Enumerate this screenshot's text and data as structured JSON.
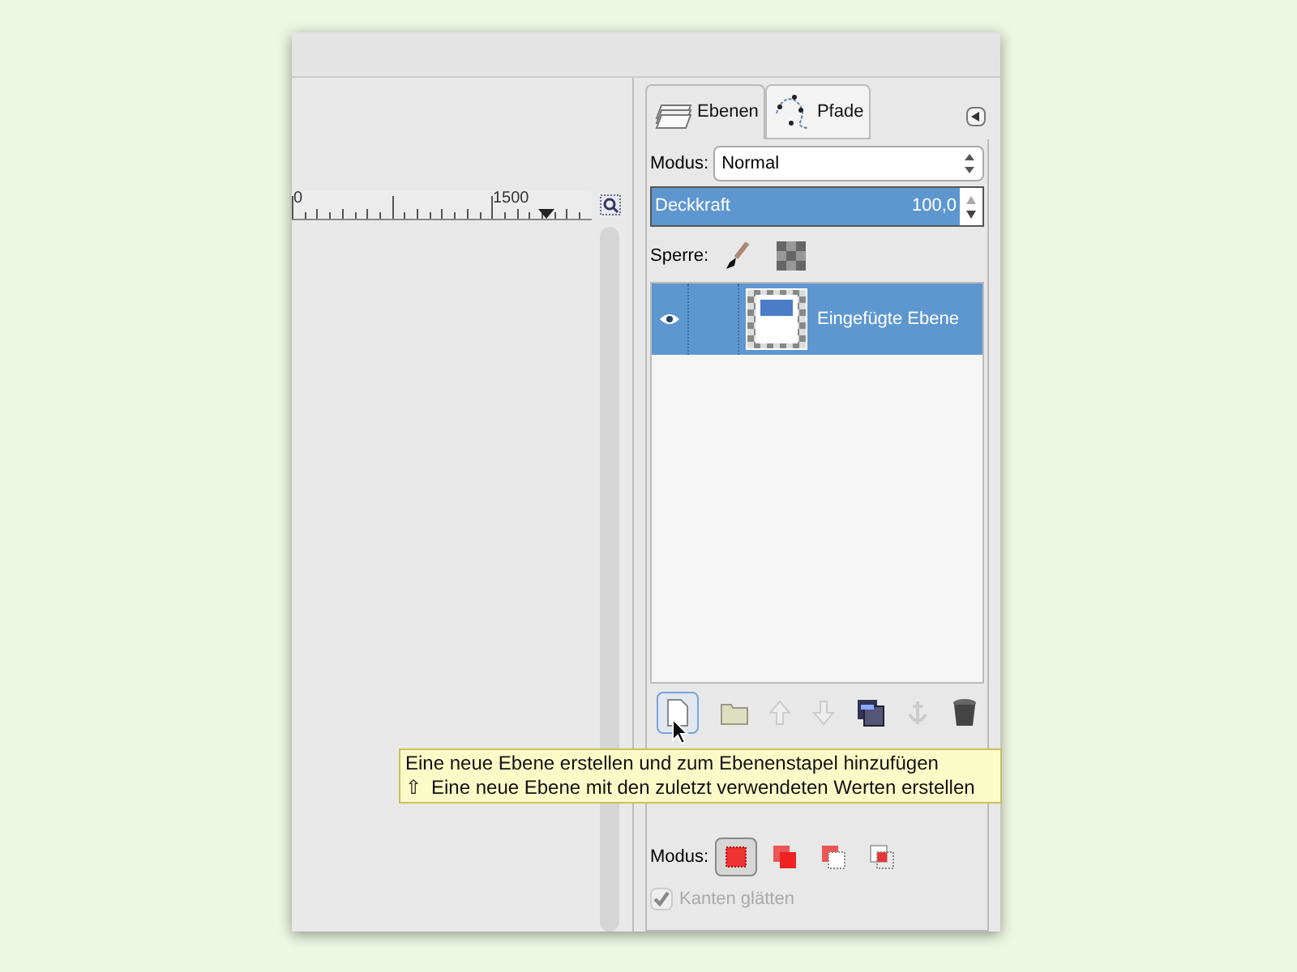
{
  "ruler": {
    "labels": [
      "0",
      "1500"
    ]
  },
  "tabs": [
    {
      "label": "Ebenen",
      "selected": true
    },
    {
      "label": "Pfade",
      "selected": false
    }
  ],
  "mode": {
    "label": "Modus:",
    "value": "Normal"
  },
  "opacity": {
    "label": "Deckkraft",
    "value": "100,0",
    "level": 1
  },
  "lock": {
    "label": "Sperre:"
  },
  "layers": [
    {
      "name": "Eingefügte Ebene",
      "selected": true,
      "visible": true
    }
  ],
  "tooltip": {
    "title": "Eine neue Ebene erstellen und zum Ebenenstapel hinzufügen",
    "shift_icon": "⇧",
    "hint": "Eine neue Ebene mit den zuletzt verwendeten Werten erstellen"
  },
  "tool_options": {
    "mode_label": "Modus:",
    "modes": [
      {
        "selected": true
      },
      {
        "selected": false
      },
      {
        "selected": false
      },
      {
        "selected": false
      }
    ],
    "antialias": {
      "label": "Kanten glätten",
      "checked": true,
      "disabled": true
    }
  }
}
